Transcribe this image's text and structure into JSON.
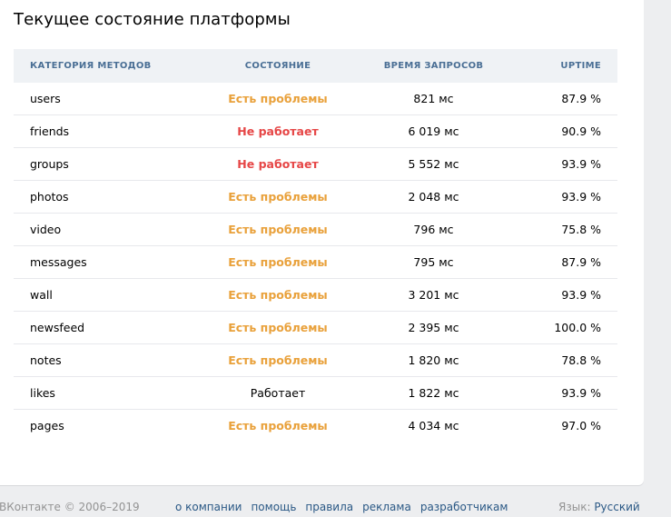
{
  "page_title": "Текущее состояние платформы",
  "table": {
    "headers": {
      "category": "КАТЕГОРИЯ МЕТОДОВ",
      "status": "СОСТОЯНИЕ",
      "time": "ВРЕМЯ ЗАПРОСОВ",
      "uptime": "UPTIME"
    },
    "rows": [
      {
        "name": "users",
        "status": "Есть проблемы",
        "status_type": "warn",
        "time": "821 мс",
        "uptime": "87.9 %"
      },
      {
        "name": "friends",
        "status": "Не работает",
        "status_type": "down",
        "time": "6 019 мс",
        "uptime": "90.9 %"
      },
      {
        "name": "groups",
        "status": "Не работает",
        "status_type": "down",
        "time": "5 552 мс",
        "uptime": "93.9 %"
      },
      {
        "name": "photos",
        "status": "Есть проблемы",
        "status_type": "warn",
        "time": "2 048 мс",
        "uptime": "93.9 %"
      },
      {
        "name": "video",
        "status": "Есть проблемы",
        "status_type": "warn",
        "time": "796 мс",
        "uptime": "75.8 %"
      },
      {
        "name": "messages",
        "status": "Есть проблемы",
        "status_type": "warn",
        "time": "795 мс",
        "uptime": "87.9 %"
      },
      {
        "name": "wall",
        "status": "Есть проблемы",
        "status_type": "warn",
        "time": "3 201 мс",
        "uptime": "93.9 %"
      },
      {
        "name": "newsfeed",
        "status": "Есть проблемы",
        "status_type": "warn",
        "time": "2 395 мс",
        "uptime": "100.0 %"
      },
      {
        "name": "notes",
        "status": "Есть проблемы",
        "status_type": "warn",
        "time": "1 820 мс",
        "uptime": "78.8 %"
      },
      {
        "name": "likes",
        "status": "Работает",
        "status_type": "ok",
        "time": "1 822 мс",
        "uptime": "93.9 %"
      },
      {
        "name": "pages",
        "status": "Есть проблемы",
        "status_type": "warn",
        "time": "4 034 мс",
        "uptime": "97.0 %"
      }
    ]
  },
  "colors": {
    "status_warn": "#e9a13b",
    "status_down": "#e64646",
    "status_ok": "#000000",
    "header_text": "#4a6f95",
    "link": "#2a5885"
  },
  "footer": {
    "copyright": "ВКонтакте © 2006–2019",
    "links": [
      "о компании",
      "помощь",
      "правила",
      "реклама",
      "разработчикам"
    ],
    "language_label": "Язык:",
    "language_value": "Русский"
  }
}
